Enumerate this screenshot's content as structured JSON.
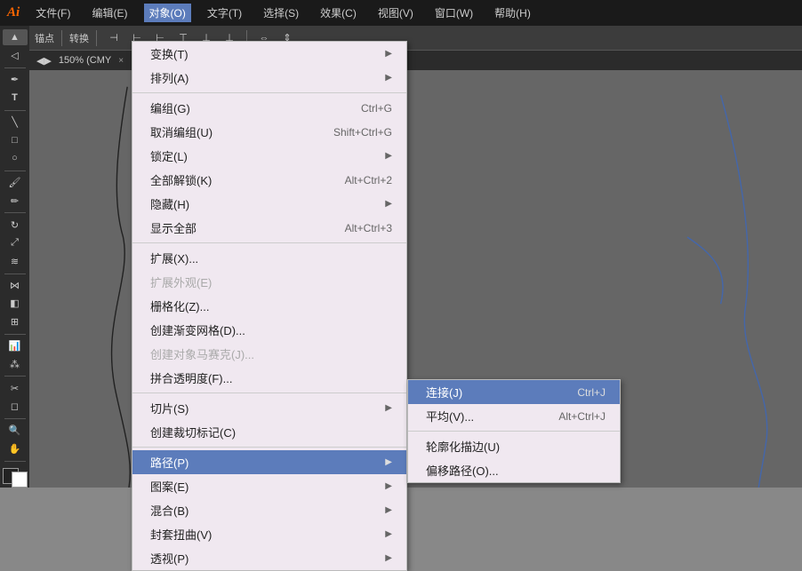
{
  "titlebar": {
    "logo": "Ai",
    "menus": [
      "文件(F)",
      "编辑(E)",
      "对象(O)",
      "文字(T)",
      "选择(S)",
      "效果(C)",
      "视图(V)",
      "窗口(W)",
      "帮助(H)"
    ]
  },
  "canvas_tab": {
    "label": "150% (CMY",
    "close": "×"
  },
  "object_menu": {
    "title": "对象(O)",
    "items": [
      {
        "label": "变换(T)",
        "shortcut": "",
        "arrow": "▶",
        "type": "submenu"
      },
      {
        "label": "排列(A)",
        "shortcut": "",
        "arrow": "▶",
        "type": "submenu"
      },
      {
        "label": "sep1",
        "type": "separator"
      },
      {
        "label": "编组(G)",
        "shortcut": "Ctrl+G",
        "type": "normal"
      },
      {
        "label": "取消编组(U)",
        "shortcut": "Shift+Ctrl+G",
        "type": "normal"
      },
      {
        "label": "锁定(L)",
        "shortcut": "",
        "arrow": "▶",
        "type": "submenu"
      },
      {
        "label": "全部解锁(K)",
        "shortcut": "Alt+Ctrl+2",
        "type": "normal"
      },
      {
        "label": "隐藏(H)",
        "shortcut": "",
        "arrow": "▶",
        "type": "submenu"
      },
      {
        "label": "显示全部",
        "shortcut": "Alt+Ctrl+3",
        "type": "normal"
      },
      {
        "label": "sep2",
        "type": "separator"
      },
      {
        "label": "扩展(X)...",
        "shortcut": "",
        "type": "normal"
      },
      {
        "label": "扩展外观(E)",
        "shortcut": "",
        "type": "disabled"
      },
      {
        "label": "栅格化(Z)...",
        "shortcut": "",
        "type": "normal"
      },
      {
        "label": "创建渐变网格(D)...",
        "shortcut": "",
        "type": "normal"
      },
      {
        "label": "创建对象马赛克(J)...",
        "shortcut": "",
        "type": "disabled"
      },
      {
        "label": "拼合透明度(F)...",
        "shortcut": "",
        "type": "normal"
      },
      {
        "label": "sep3",
        "type": "separator"
      },
      {
        "label": "切片(S)",
        "shortcut": "",
        "arrow": "▶",
        "type": "submenu"
      },
      {
        "label": "创建裁切标记(C)",
        "shortcut": "",
        "type": "normal"
      },
      {
        "label": "sep4",
        "type": "separator"
      },
      {
        "label": "路径(P)",
        "shortcut": "",
        "arrow": "▶",
        "type": "highlighted"
      },
      {
        "label": "图案(E)",
        "shortcut": "",
        "arrow": "▶",
        "type": "submenu"
      },
      {
        "label": "混合(B)",
        "shortcut": "",
        "arrow": "▶",
        "type": "submenu"
      },
      {
        "label": "封套扭曲(V)",
        "shortcut": "",
        "arrow": "▶",
        "type": "submenu"
      },
      {
        "label": "透视(P)",
        "shortcut": "",
        "arrow": "▶",
        "type": "submenu"
      }
    ]
  },
  "path_submenu": {
    "items": [
      {
        "label": "连接(J)",
        "shortcut": "Ctrl+J",
        "type": "highlighted"
      },
      {
        "label": "平均(V)...",
        "shortcut": "Alt+Ctrl+J",
        "type": "normal"
      },
      {
        "label": "sep1",
        "type": "separator"
      },
      {
        "label": "轮廓化描边(U)",
        "shortcut": "",
        "type": "normal"
      },
      {
        "label": "偏移路径(O)...",
        "shortcut": "",
        "type": "normal"
      }
    ]
  },
  "toolbar": {
    "anchor_label": "锚点",
    "convert_label": "转换"
  }
}
